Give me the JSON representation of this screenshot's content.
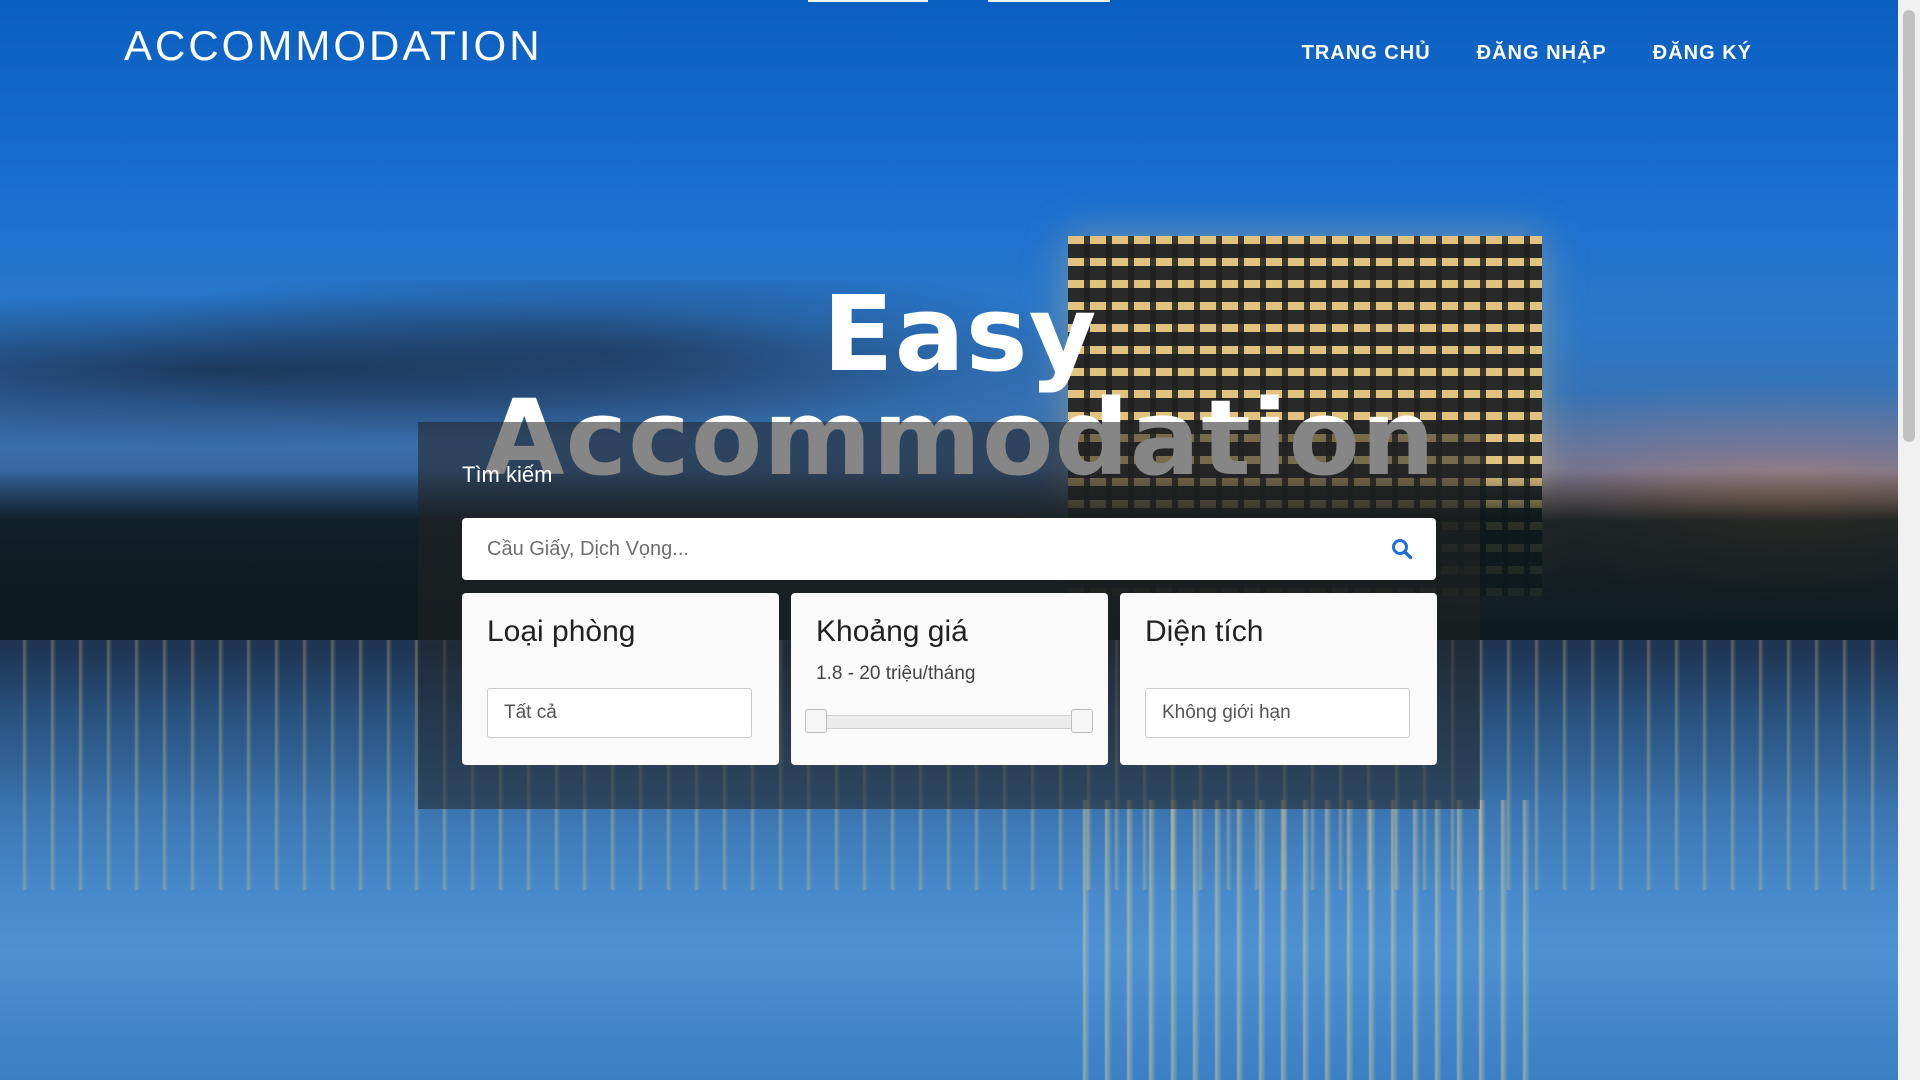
{
  "brand": "ACCOMMODATION",
  "nav": {
    "home": "TRANG CHỦ",
    "login": "ĐĂNG NHẬP",
    "register": "ĐĂNG KÝ"
  },
  "hero": {
    "title": "Easy Accommodation"
  },
  "search": {
    "label": "Tìm kiếm",
    "placeholder": "Cầu Giấy, Dịch Vọng...",
    "value": "",
    "icon": "search-icon"
  },
  "filters": {
    "room_type": {
      "title": "Loại phòng",
      "value": "Tất cả"
    },
    "price": {
      "title": "Khoảng giá",
      "range_text": "1.8 - 20 triệu/tháng",
      "min_fraction": 0.0,
      "max_fraction": 1.0
    },
    "area": {
      "title": "Diện tích",
      "value": "Không giới hạn"
    }
  },
  "colors": {
    "accent": "#1e6fd9",
    "panel": "rgba(34,34,34,0.55)",
    "card": "#fafafa"
  }
}
